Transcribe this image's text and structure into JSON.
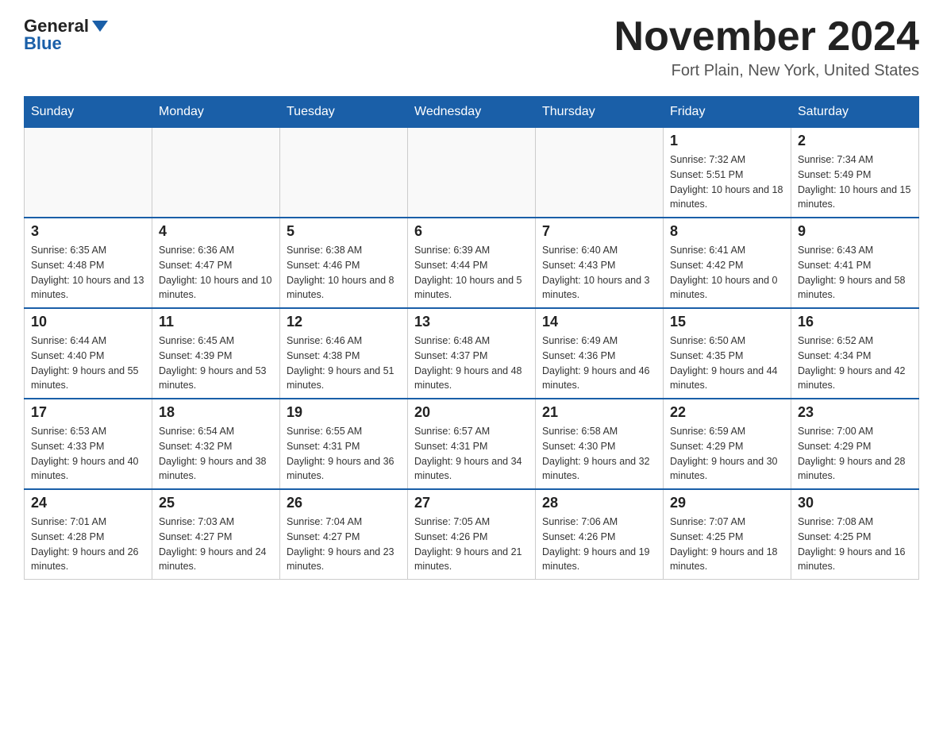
{
  "logo": {
    "general": "General",
    "blue": "Blue"
  },
  "title": "November 2024",
  "location": "Fort Plain, New York, United States",
  "days_of_week": [
    "Sunday",
    "Monday",
    "Tuesday",
    "Wednesday",
    "Thursday",
    "Friday",
    "Saturday"
  ],
  "weeks": [
    [
      {
        "day": "",
        "info": ""
      },
      {
        "day": "",
        "info": ""
      },
      {
        "day": "",
        "info": ""
      },
      {
        "day": "",
        "info": ""
      },
      {
        "day": "",
        "info": ""
      },
      {
        "day": "1",
        "info": "Sunrise: 7:32 AM\nSunset: 5:51 PM\nDaylight: 10 hours and 18 minutes."
      },
      {
        "day": "2",
        "info": "Sunrise: 7:34 AM\nSunset: 5:49 PM\nDaylight: 10 hours and 15 minutes."
      }
    ],
    [
      {
        "day": "3",
        "info": "Sunrise: 6:35 AM\nSunset: 4:48 PM\nDaylight: 10 hours and 13 minutes."
      },
      {
        "day": "4",
        "info": "Sunrise: 6:36 AM\nSunset: 4:47 PM\nDaylight: 10 hours and 10 minutes."
      },
      {
        "day": "5",
        "info": "Sunrise: 6:38 AM\nSunset: 4:46 PM\nDaylight: 10 hours and 8 minutes."
      },
      {
        "day": "6",
        "info": "Sunrise: 6:39 AM\nSunset: 4:44 PM\nDaylight: 10 hours and 5 minutes."
      },
      {
        "day": "7",
        "info": "Sunrise: 6:40 AM\nSunset: 4:43 PM\nDaylight: 10 hours and 3 minutes."
      },
      {
        "day": "8",
        "info": "Sunrise: 6:41 AM\nSunset: 4:42 PM\nDaylight: 10 hours and 0 minutes."
      },
      {
        "day": "9",
        "info": "Sunrise: 6:43 AM\nSunset: 4:41 PM\nDaylight: 9 hours and 58 minutes."
      }
    ],
    [
      {
        "day": "10",
        "info": "Sunrise: 6:44 AM\nSunset: 4:40 PM\nDaylight: 9 hours and 55 minutes."
      },
      {
        "day": "11",
        "info": "Sunrise: 6:45 AM\nSunset: 4:39 PM\nDaylight: 9 hours and 53 minutes."
      },
      {
        "day": "12",
        "info": "Sunrise: 6:46 AM\nSunset: 4:38 PM\nDaylight: 9 hours and 51 minutes."
      },
      {
        "day": "13",
        "info": "Sunrise: 6:48 AM\nSunset: 4:37 PM\nDaylight: 9 hours and 48 minutes."
      },
      {
        "day": "14",
        "info": "Sunrise: 6:49 AM\nSunset: 4:36 PM\nDaylight: 9 hours and 46 minutes."
      },
      {
        "day": "15",
        "info": "Sunrise: 6:50 AM\nSunset: 4:35 PM\nDaylight: 9 hours and 44 minutes."
      },
      {
        "day": "16",
        "info": "Sunrise: 6:52 AM\nSunset: 4:34 PM\nDaylight: 9 hours and 42 minutes."
      }
    ],
    [
      {
        "day": "17",
        "info": "Sunrise: 6:53 AM\nSunset: 4:33 PM\nDaylight: 9 hours and 40 minutes."
      },
      {
        "day": "18",
        "info": "Sunrise: 6:54 AM\nSunset: 4:32 PM\nDaylight: 9 hours and 38 minutes."
      },
      {
        "day": "19",
        "info": "Sunrise: 6:55 AM\nSunset: 4:31 PM\nDaylight: 9 hours and 36 minutes."
      },
      {
        "day": "20",
        "info": "Sunrise: 6:57 AM\nSunset: 4:31 PM\nDaylight: 9 hours and 34 minutes."
      },
      {
        "day": "21",
        "info": "Sunrise: 6:58 AM\nSunset: 4:30 PM\nDaylight: 9 hours and 32 minutes."
      },
      {
        "day": "22",
        "info": "Sunrise: 6:59 AM\nSunset: 4:29 PM\nDaylight: 9 hours and 30 minutes."
      },
      {
        "day": "23",
        "info": "Sunrise: 7:00 AM\nSunset: 4:29 PM\nDaylight: 9 hours and 28 minutes."
      }
    ],
    [
      {
        "day": "24",
        "info": "Sunrise: 7:01 AM\nSunset: 4:28 PM\nDaylight: 9 hours and 26 minutes."
      },
      {
        "day": "25",
        "info": "Sunrise: 7:03 AM\nSunset: 4:27 PM\nDaylight: 9 hours and 24 minutes."
      },
      {
        "day": "26",
        "info": "Sunrise: 7:04 AM\nSunset: 4:27 PM\nDaylight: 9 hours and 23 minutes."
      },
      {
        "day": "27",
        "info": "Sunrise: 7:05 AM\nSunset: 4:26 PM\nDaylight: 9 hours and 21 minutes."
      },
      {
        "day": "28",
        "info": "Sunrise: 7:06 AM\nSunset: 4:26 PM\nDaylight: 9 hours and 19 minutes."
      },
      {
        "day": "29",
        "info": "Sunrise: 7:07 AM\nSunset: 4:25 PM\nDaylight: 9 hours and 18 minutes."
      },
      {
        "day": "30",
        "info": "Sunrise: 7:08 AM\nSunset: 4:25 PM\nDaylight: 9 hours and 16 minutes."
      }
    ]
  ]
}
